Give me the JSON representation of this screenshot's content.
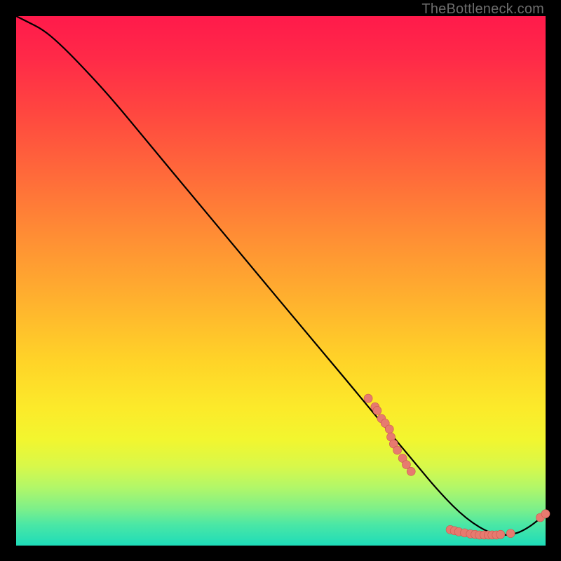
{
  "watermark": "TheBottleneck.com",
  "colors": {
    "line": "#000000",
    "marker_fill": "#e77a6f",
    "marker_stroke": "#c9584f",
    "background_black": "#000000"
  },
  "chart_data": {
    "type": "line",
    "title": "",
    "xlabel": "",
    "ylabel": "",
    "xlim": [
      0,
      100
    ],
    "ylim": [
      0,
      100
    ],
    "grid": false,
    "legend": false,
    "series": [
      {
        "name": "bottleneck-curve",
        "x": [
          0,
          2,
          5,
          8,
          12,
          18,
          25,
          35,
          45,
          55,
          63,
          70,
          75,
          80,
          85,
          90,
          94,
          97,
          100
        ],
        "values": [
          100,
          99,
          97.5,
          95,
          91,
          84.5,
          76,
          64,
          52,
          40,
          30.5,
          22,
          16,
          10,
          5,
          2,
          2,
          3.5,
          6
        ]
      }
    ],
    "markers": [
      {
        "name": "cluster-descent",
        "points": [
          {
            "x": 66.5,
            "y": 27.8
          },
          {
            "x": 67.8,
            "y": 26.2
          },
          {
            "x": 68.2,
            "y": 25.5
          },
          {
            "x": 69.0,
            "y": 24.0
          },
          {
            "x": 69.7,
            "y": 23.1
          },
          {
            "x": 70.5,
            "y": 22.0
          },
          {
            "x": 70.8,
            "y": 20.5
          },
          {
            "x": 71.3,
            "y": 19.2
          },
          {
            "x": 72.0,
            "y": 18.0
          },
          {
            "x": 73.0,
            "y": 16.5
          },
          {
            "x": 73.7,
            "y": 15.3
          },
          {
            "x": 74.6,
            "y": 14.0
          }
        ]
      },
      {
        "name": "cluster-valley",
        "points": [
          {
            "x": 82.0,
            "y": 3.0
          },
          {
            "x": 82.8,
            "y": 2.8
          },
          {
            "x": 83.6,
            "y": 2.6
          },
          {
            "x": 84.7,
            "y": 2.4
          },
          {
            "x": 85.8,
            "y": 2.2
          },
          {
            "x": 86.7,
            "y": 2.1
          },
          {
            "x": 87.5,
            "y": 2.0
          },
          {
            "x": 88.4,
            "y": 2.0
          },
          {
            "x": 89.2,
            "y": 2.0
          },
          {
            "x": 89.9,
            "y": 2.0
          },
          {
            "x": 90.7,
            "y": 2.0
          },
          {
            "x": 91.5,
            "y": 2.1
          },
          {
            "x": 93.4,
            "y": 2.3
          }
        ]
      },
      {
        "name": "cluster-rise",
        "points": [
          {
            "x": 99.0,
            "y": 5.3
          },
          {
            "x": 100.0,
            "y": 6.0
          }
        ]
      }
    ]
  }
}
